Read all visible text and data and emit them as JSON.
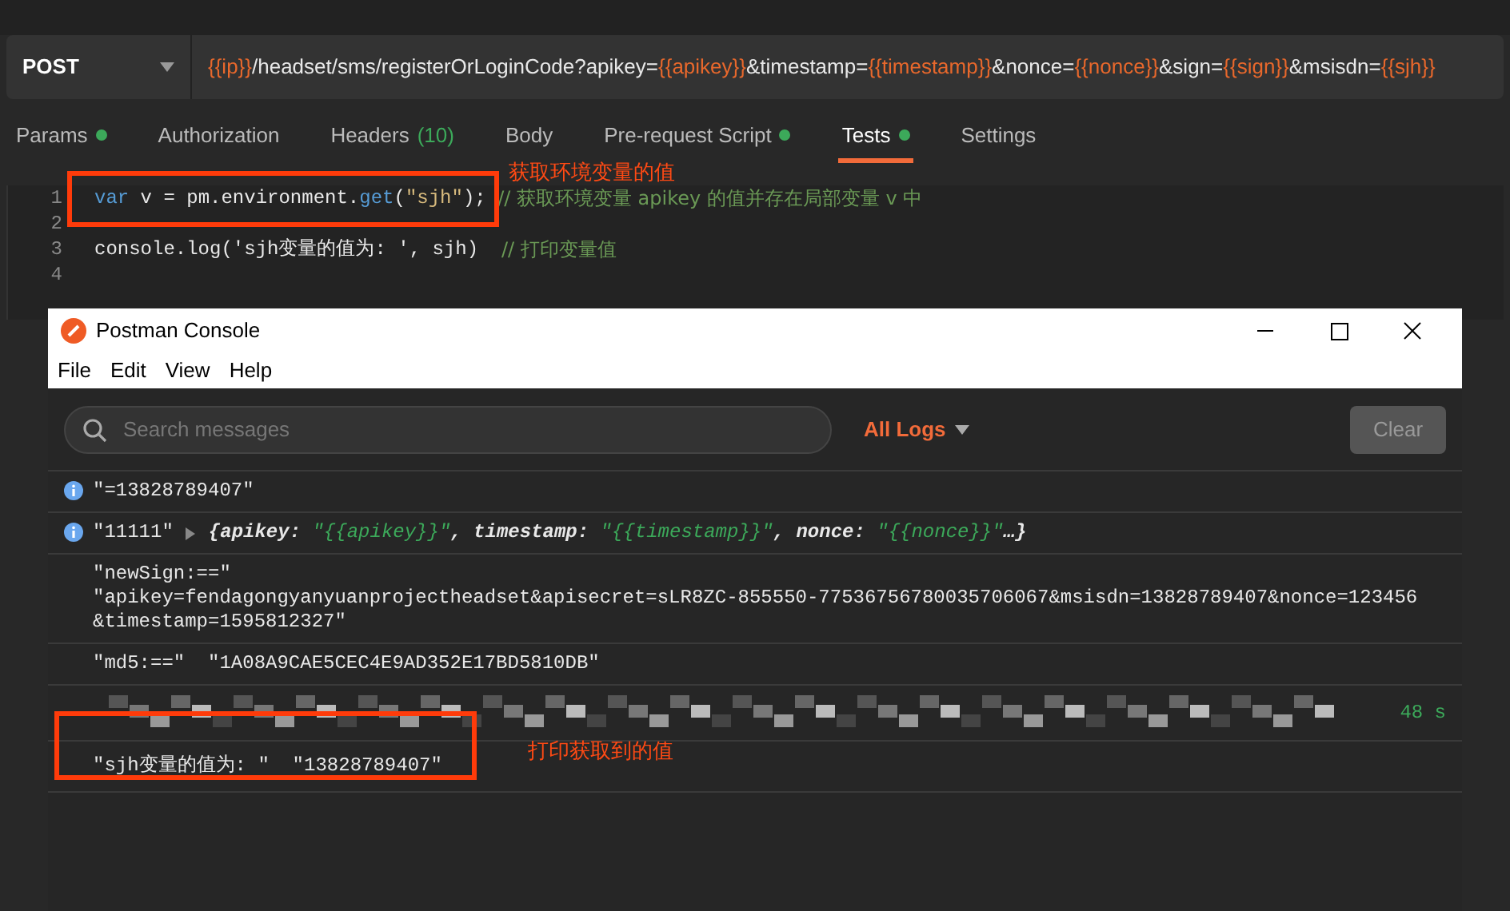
{
  "request": {
    "method": "POST",
    "url_parts": [
      {
        "text": "{{ip}}",
        "kind": "var"
      },
      {
        "text": "/headset/sms/registerOrLoginCode?apikey=",
        "kind": "plain"
      },
      {
        "text": "{{apikey}}",
        "kind": "var"
      },
      {
        "text": "&timestamp=",
        "kind": "plain"
      },
      {
        "text": "{{timestamp}}",
        "kind": "var"
      },
      {
        "text": "&nonce=",
        "kind": "plain"
      },
      {
        "text": "{{nonce}}",
        "kind": "var"
      },
      {
        "text": "&sign=",
        "kind": "plain"
      },
      {
        "text": "{{sign}}",
        "kind": "var"
      },
      {
        "text": "&msisdn=",
        "kind": "plain"
      },
      {
        "text": "{{sjh}}",
        "kind": "var"
      }
    ]
  },
  "tabs": [
    {
      "label": "Params",
      "dot": true,
      "selected": false
    },
    {
      "label": "Authorization",
      "dot": false,
      "selected": false
    },
    {
      "label": "Headers",
      "count": "(10)",
      "dot": false,
      "selected": false
    },
    {
      "label": "Body",
      "dot": false,
      "selected": false
    },
    {
      "label": "Pre-request Script",
      "dot": true,
      "selected": false
    },
    {
      "label": "Tests",
      "dot": true,
      "selected": true
    },
    {
      "label": "Settings",
      "dot": false,
      "selected": false
    }
  ],
  "editor": {
    "lines": [
      {
        "number": "1",
        "tokens": [
          {
            "text": "var",
            "kind": "keyword"
          },
          {
            "text": " v = pm.environment.",
            "kind": "plain"
          },
          {
            "text": "get",
            "kind": "func"
          },
          {
            "text": "(",
            "kind": "plain"
          },
          {
            "text": "\"sjh\"",
            "kind": "string"
          },
          {
            "text": "); ",
            "kind": "plain"
          },
          {
            "text": "// 获取环境变量 apikey 的值并存在局部变量 v 中",
            "kind": "comment"
          }
        ]
      },
      {
        "number": "2"
      },
      {
        "number": "3",
        "tokens": [
          {
            "text": "console.log('sjh变量的值为: ', sjh)  ",
            "kind": "plain"
          },
          {
            "text": "// 打印变量值",
            "kind": "comment"
          }
        ]
      },
      {
        "number": "4"
      }
    ]
  },
  "console": {
    "title": "Postman Console",
    "menu": [
      "File",
      "Edit",
      "View",
      "Help"
    ],
    "search": {
      "placeholder": "Search messages"
    },
    "filter": "All Logs",
    "clear_button": "Clear",
    "logs": [
      {
        "kind": "info",
        "lines": [
          "\"=13828789407\""
        ]
      },
      {
        "kind": "object",
        "label": "\"11111\"",
        "tokens": [
          {
            "text": "{apikey: ",
            "kind": "key"
          },
          {
            "text": "\"{{apikey}}\"",
            "kind": "value"
          },
          {
            "text": ", timestamp: ",
            "kind": "key"
          },
          {
            "text": "\"{{timestamp}}\"",
            "kind": "value"
          },
          {
            "text": ", nonce: ",
            "kind": "key"
          },
          {
            "text": "\"{{nonce}}\"",
            "kind": "value"
          },
          {
            "text": "…}",
            "kind": "key"
          }
        ]
      },
      {
        "kind": "plain",
        "lines": [
          "\"newSign:==\"",
          "\"apikey=fendagongyanyuanprojectheadset&apisecret=sLR8ZC-855550-77536756780035706067&msisdn=13828789407&nonce=123456",
          "&timestamp=1595812327\""
        ]
      },
      {
        "kind": "plain",
        "lines": [
          "\"md5:==\"  \"1A08A9CAE5CEC4E9AD352E17BD5810DB\""
        ]
      },
      {
        "kind": "redacted",
        "time": "48 s"
      },
      {
        "kind": "plain",
        "lines": [
          "\"sjh变量的值为: \"  \"13828789407\""
        ]
      }
    ]
  },
  "annotations": [
    {
      "text": "获取环境变量的值"
    },
    {
      "text": "打印获取到的值"
    }
  ]
}
